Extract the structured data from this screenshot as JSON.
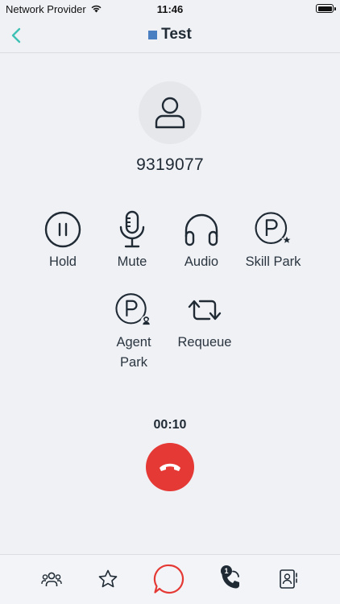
{
  "status_bar": {
    "carrier": "Network Provider",
    "time": "11:46"
  },
  "header": {
    "title": "Test",
    "status_color": "#4a7fc1"
  },
  "caller": {
    "number": "9319077"
  },
  "actions": {
    "hold": "Hold",
    "mute": "Mute",
    "audio": "Audio",
    "skill_park": "Skill Park",
    "agent_park_line1": "Agent",
    "agent_park_line2": "Park",
    "requeue": "Requeue"
  },
  "call": {
    "timer": "00:10",
    "hangup_color": "#e53935"
  },
  "tabs": {
    "calls_badge": "1"
  },
  "colors": {
    "accent": "#3ec1b4",
    "text": "#1f2a35",
    "chat_ring": "#e53935"
  }
}
